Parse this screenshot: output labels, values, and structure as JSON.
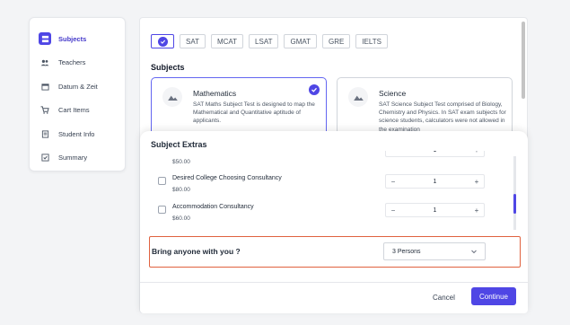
{
  "sidebar": {
    "items": [
      {
        "label": "Subjects",
        "icon": "subjects-icon"
      },
      {
        "label": "Teachers",
        "icon": "teachers-icon"
      },
      {
        "label": "Datum & Zeit",
        "icon": "calendar-icon"
      },
      {
        "label": "Cart Items",
        "icon": "cart-icon"
      },
      {
        "label": "Student Info",
        "icon": "student-info-icon"
      },
      {
        "label": "Summary",
        "icon": "summary-icon"
      }
    ]
  },
  "exams": [
    "SAT",
    "MCAT",
    "LSAT",
    "GMAT",
    "GRE",
    "IELTS"
  ],
  "subjects": {
    "title": "Subjects",
    "cards": [
      {
        "name": "Mathematics",
        "description": "SAT Maths Subject Test is designed to map the Mathematical and Quantitative aptitude of applicants."
      },
      {
        "name": "Science",
        "description": "SAT Science Subject Test comprised of Biology, Chemistry and Physics. In SAT exam subjects for science students, calculators were not allowed in the examination"
      }
    ]
  },
  "modal": {
    "title": "Subject Extras",
    "extras": [
      {
        "name": "",
        "price": "$50.00",
        "qty": "1"
      },
      {
        "name": "Desired College Choosing Consultancy",
        "price": "$80.00",
        "qty": "1"
      },
      {
        "name": "Accommodation Consultancy",
        "price": "$60.00",
        "qty": "1"
      }
    ],
    "bring_question": "Bring anyone with you ?",
    "bring_value": "3 Persons",
    "cancel_label": "Cancel",
    "continue_label": "Continue"
  },
  "colors": {
    "accent": "#4f46e5",
    "highlight_border": "#e0623f"
  }
}
